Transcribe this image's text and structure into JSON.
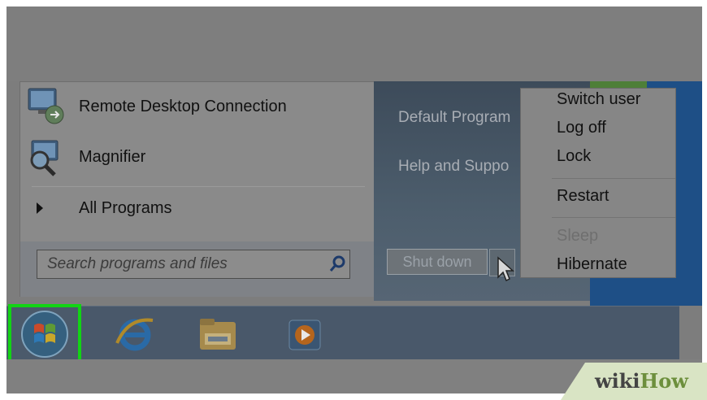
{
  "start_menu": {
    "programs": [
      {
        "label": "Remote Desktop Connection",
        "icon": "remote-desktop-icon"
      },
      {
        "label": "Magnifier",
        "icon": "magnifier-icon"
      }
    ],
    "all_programs_label": "All Programs",
    "search": {
      "placeholder": "Search programs and files",
      "value": ""
    },
    "right_links": [
      "Default Program",
      "Help and Suppo"
    ],
    "shutdown_label": "Shut down"
  },
  "power_menu": {
    "items": [
      {
        "label": "Switch user",
        "enabled": true
      },
      {
        "label": "Log off",
        "enabled": true
      },
      {
        "label": "Lock",
        "enabled": true
      },
      {
        "label": "Restart",
        "enabled": true
      },
      {
        "label": "Sleep",
        "enabled": false
      },
      {
        "label": "Hibernate",
        "enabled": true
      }
    ]
  },
  "taskbar": {
    "items": [
      "windows-start-orb",
      "internet-explorer-icon",
      "file-explorer-icon",
      "media-player-icon"
    ]
  },
  "watermark": {
    "wiki": "wiki",
    "how": "How"
  },
  "colors": {
    "highlight": "#12d414",
    "desktop": "#1e4f86"
  }
}
